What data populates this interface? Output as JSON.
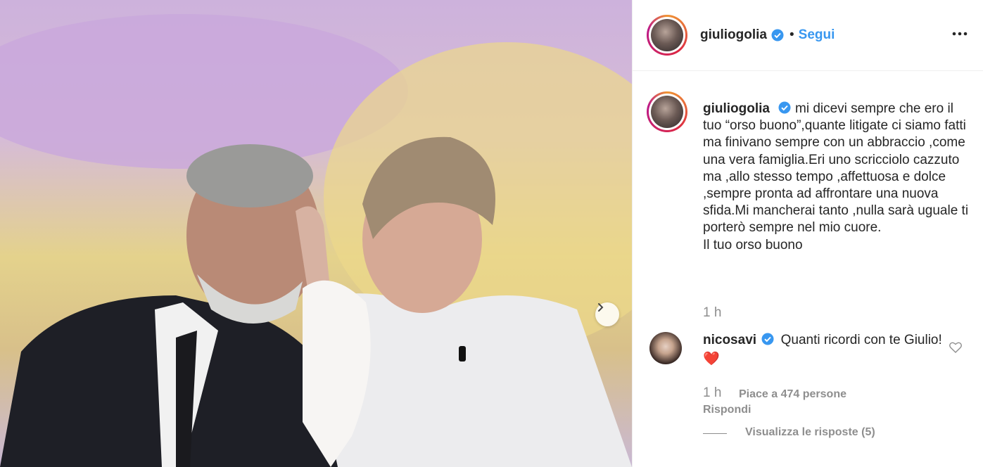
{
  "header": {
    "username": "giuliogolia",
    "separator": "•",
    "follow_label": "Segui"
  },
  "caption": {
    "username": "giuliogolia",
    "text": "mi dicevi sempre che ero il tuo “orso buono”,quante litigate ci siamo fatti ma finivano sempre con un abbraccio ,come una vera famiglia.Eri uno scricciolo cazzuto ma ,allo stesso tempo ,affettuosa e dolce ,sempre pronta ad affrontare una nuova sfida.Mi mancherai tanto ,nulla sarà uguale ti porterò sempre nel mio cuore.",
    "signature": "Il tuo orso buono",
    "time": "1 h"
  },
  "comment": {
    "username": "nicosavi",
    "text": "Quanti ricordi con te Giulio!",
    "emoji": "❤️",
    "time": "1 h",
    "likes": "Piace a 474 persone",
    "reply": "Rispondi",
    "view_replies": "Visualizza le risposte (5)"
  },
  "icons": {
    "verified": "verified-badge-icon",
    "more": "more-options-icon",
    "next": "chevron-right-icon",
    "like": "heart-outline-icon"
  },
  "colors": {
    "link": "#3897f0",
    "verified": "#3897f0",
    "muted": "#8e8e8e"
  }
}
